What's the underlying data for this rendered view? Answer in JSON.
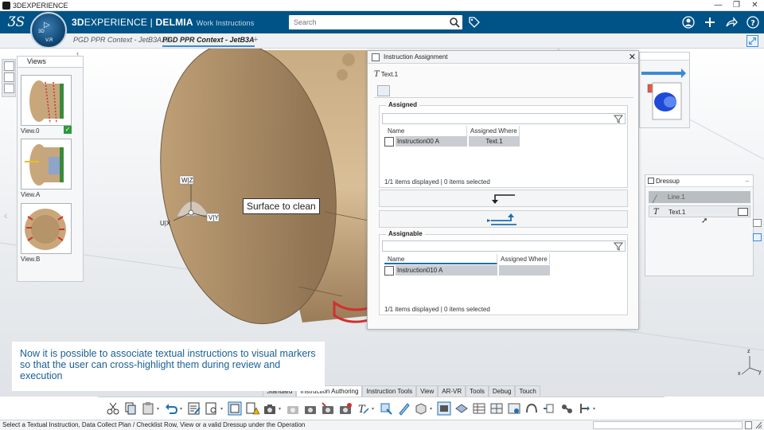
{
  "window": {
    "title": "3DEXPERIENCE",
    "controls": [
      "—",
      "❐",
      "✕"
    ]
  },
  "topbar": {
    "brand_prefix": "3D",
    "brand_experience": "EXPERIENCE",
    "brand_separator": " | ",
    "brand_name": "DELMIA",
    "app_name": "Work Instructions",
    "search_placeholder": "Search",
    "compass": {
      "label": "V.R",
      "dimension": "3D"
    }
  },
  "tabs": [
    {
      "label": "PGD PPR Context - JetB3A10",
      "active": false
    },
    {
      "label": "PGD PPR Context - JetB3A",
      "active": true
    }
  ],
  "views_panel": {
    "title": "Views",
    "views": [
      {
        "label": "View.0",
        "checked": true
      },
      {
        "label": "View.A",
        "checked": false
      },
      {
        "label": "View.B",
        "checked": false
      }
    ]
  },
  "instruction_assignment": {
    "title": "Instruction Assignment",
    "selected_text": "Text.1",
    "assigned": {
      "title": "Assigned",
      "columns": [
        "Name",
        "Assigned Where"
      ],
      "rows": [
        {
          "name": "Instruction00 A",
          "where": "Text.1"
        }
      ],
      "status": "1/1 items displayed | 0 items selected"
    },
    "assignable": {
      "title": "Assignable",
      "columns": [
        "Name",
        "Assigned Where"
      ],
      "rows": [
        {
          "name": "Instruction010 A",
          "where": ""
        }
      ],
      "status": "1/1 items displayed | 0 items selected"
    }
  },
  "dressup_panel": {
    "title": "Dressup",
    "items": [
      {
        "label": "Line.1",
        "selected": true
      },
      {
        "label": "Text.1",
        "selected": false
      }
    ]
  },
  "viewport": {
    "annotation": "Surface to clean",
    "robot_axes": {
      "z": "W|Z",
      "y": "V|Y",
      "x": "U|X"
    },
    "triad": {
      "x": "x",
      "y": "y",
      "z": "z"
    }
  },
  "caption": "Now it is possible to associate textual instructions to visual markers so that the user can cross-highlight them during review and execution",
  "section_tabs": [
    {
      "label": "Standard",
      "active": false
    },
    {
      "label": "Instruction Authoring",
      "active": true
    },
    {
      "label": "Instruction Tools",
      "active": false
    },
    {
      "label": "View",
      "active": false
    },
    {
      "label": "AR-VR",
      "active": false
    },
    {
      "label": "Tools",
      "active": false
    },
    {
      "label": "Debug",
      "active": false
    },
    {
      "label": "Touch",
      "active": false
    }
  ],
  "statusbar": {
    "message": "Select a Textual Instruction, Data Collect Plan / Checklist Row, View or a valid Dressup under the Operation"
  },
  "colors": {
    "topbar": "#005386",
    "accent": "#3b8ad8",
    "part": "#a88a62",
    "caption_text": "#1a5f93",
    "check_green": "#2e9a3a"
  }
}
